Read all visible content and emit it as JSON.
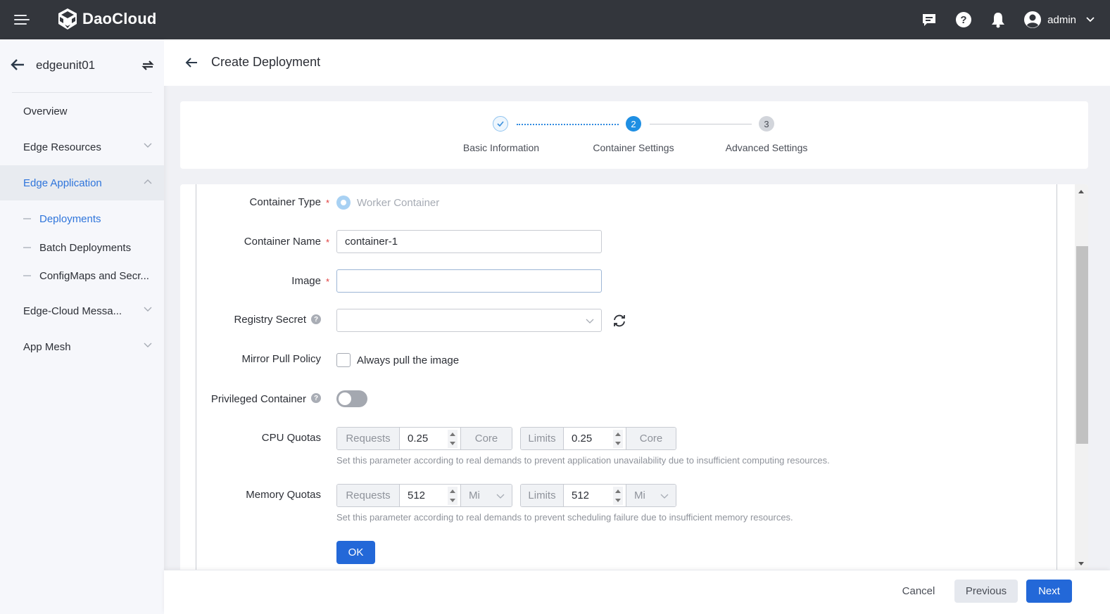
{
  "topbar": {
    "brand": "DaoCloud",
    "icons": [
      "message-icon",
      "help-icon",
      "bell-icon"
    ],
    "user": "admin"
  },
  "sidebar": {
    "title": "edgeunit01",
    "items": [
      {
        "label": "Overview",
        "expandable": false
      },
      {
        "label": "Edge Resources",
        "expandable": true,
        "expanded": false
      },
      {
        "label": "Edge Application",
        "expandable": true,
        "expanded": true,
        "active": true
      },
      {
        "label": "Edge-Cloud Messa...",
        "expandable": true,
        "expanded": false
      },
      {
        "label": "App Mesh",
        "expandable": true,
        "expanded": false
      }
    ],
    "subitems": [
      {
        "label": "Deployments",
        "active": true
      },
      {
        "label": "Batch Deployments",
        "active": false
      },
      {
        "label": "ConfigMaps and Secr...",
        "active": false
      }
    ]
  },
  "header": {
    "title": "Create Deployment"
  },
  "steps": [
    {
      "number": "1",
      "label": "Basic Information",
      "status": "done"
    },
    {
      "number": "2",
      "label": "Container Settings",
      "status": "current"
    },
    {
      "number": "3",
      "label": "Advanced Settings",
      "status": "pending"
    }
  ],
  "form": {
    "container_type": {
      "label": "Container Type",
      "value": "Worker Container"
    },
    "container_name": {
      "label": "Container Name",
      "value": "container-1"
    },
    "image": {
      "label": "Image",
      "value": ""
    },
    "registry_secret": {
      "label": "Registry Secret",
      "value": ""
    },
    "pull_policy": {
      "label": "Mirror Pull Policy",
      "option": "Always pull the image",
      "checked": false
    },
    "privileged": {
      "label": "Privileged Container",
      "enabled": false
    },
    "cpu": {
      "label": "CPU Quotas",
      "requests_label": "Requests",
      "requests_value": "0.25",
      "requests_unit": "Core",
      "limits_label": "Limits",
      "limits_value": "0.25",
      "limits_unit": "Core",
      "hint": "Set this parameter according to real demands to prevent application unavailability due to insufficient computing resources."
    },
    "memory": {
      "label": "Memory Quotas",
      "requests_label": "Requests",
      "requests_value": "512",
      "requests_unit": "Mi",
      "limits_label": "Limits",
      "limits_value": "512",
      "limits_unit": "Mi",
      "hint": "Set this parameter according to real demands to prevent scheduling failure due to insufficient memory resources."
    },
    "ok_label": "OK"
  },
  "footer": {
    "cancel": "Cancel",
    "previous": "Previous",
    "next": "Next"
  },
  "colors": {
    "primary": "#2368d8",
    "step_active": "#1f8fe3",
    "topbar": "#33363c"
  }
}
